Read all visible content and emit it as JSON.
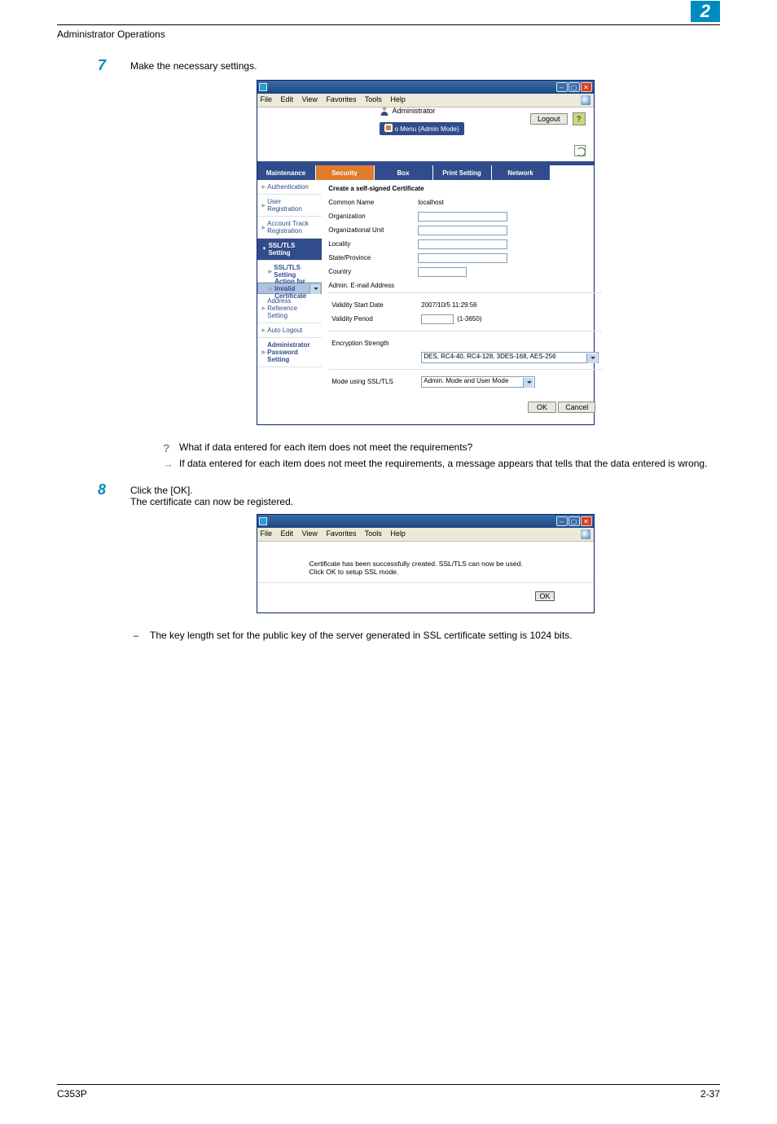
{
  "header": {
    "section": "Administrator Operations",
    "chapter": "2"
  },
  "step7": {
    "num": "7",
    "text": "Make the necessary settings.",
    "q": "What if data entered for each item does not meet the requirements?",
    "a": "If data entered for each item does not meet the requirements, a message appears that tells that the data entered is wrong."
  },
  "step8": {
    "num": "8",
    "text1": "Click the [OK].",
    "text2": "The certificate can now be registered.",
    "msg": "Certificate has been successfully created. SSL/TLS can now be used.\nClick OK to setup SSL mode.",
    "ok": "OK",
    "note": "The key length set for the public key of the server generated in SSL certificate setting is 1024 bits."
  },
  "win": {
    "menu": {
      "file": "File",
      "edit": "Edit",
      "view": "View",
      "fav": "Favorites",
      "tools": "Tools",
      "help": "Help"
    },
    "admin": "Administrator",
    "adminmenu": "o Menu (Admin Mode)",
    "logout": "Logout",
    "help": "?",
    "tabs": {
      "maint": "Maintenance",
      "security": "Security",
      "box": "Box",
      "print": "Print Setting",
      "network": "Network"
    },
    "side": {
      "auth": "Authentication",
      "userreg": "User Registration",
      "acct": "Account Track Registration",
      "ssl": "SSL/TLS Setting",
      "sslsub": "SSL/TLS Setting",
      "actinv": "Action for Invalid Certificate",
      "addr": "Address Reference Setting",
      "autolog": "Auto Logout",
      "admpw": "Administrator Password Setting"
    },
    "form": {
      "title": "Create a self-signed Certificate",
      "common": "Common Name",
      "common_val": "localhost",
      "org": "Organization",
      "orgunit": "Organizational Unit",
      "locality": "Locality",
      "state": "State/Province",
      "country": "Country",
      "email": "Admin. E-mail Address",
      "vstart": "Validity Start Date",
      "vstart_val": "2007/10/5 11:29:56",
      "vperiod": "Validity Period",
      "vperiod_hint": "(1-3650)",
      "enc": "Encryption Strength",
      "enc_val": "DES, RC4-40, RC4-128, 3DES-168, AES-256",
      "mode": "Mode using SSL/TLS",
      "mode_val": "Admin. Mode and User Mode",
      "ok": "OK",
      "cancel": "Cancel"
    }
  },
  "footer": {
    "model": "C353P",
    "page": "2-37"
  }
}
